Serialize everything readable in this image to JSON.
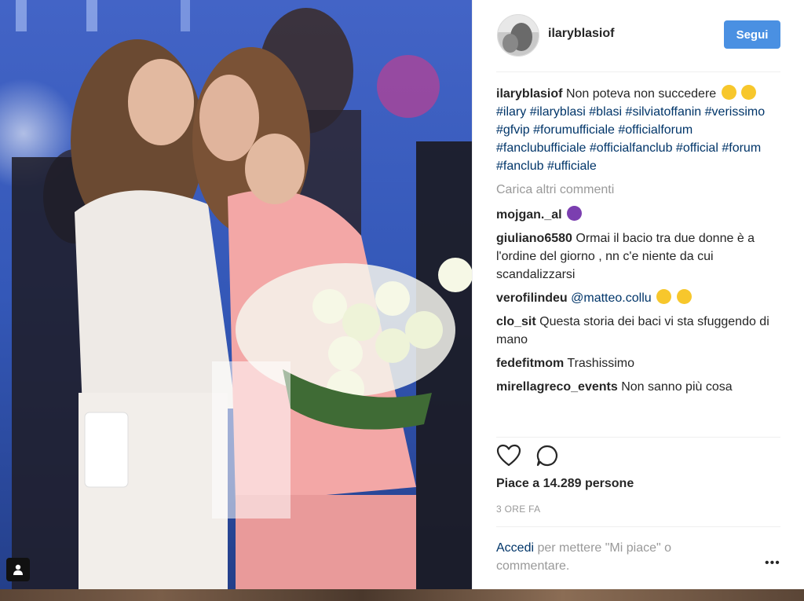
{
  "post": {
    "username": "ilaryblasiof",
    "follow_label": "Segui",
    "caption_user": "ilaryblasiof",
    "caption_text": "Non poteva non succedere",
    "hashtags": [
      "#ilary",
      "#ilaryblasi",
      "#blasi",
      "#silviatoffanin",
      "#verissimo",
      "#gfvip",
      "#forumufficiale",
      "#officialforum",
      "#fanclubufficiale",
      "#officialfanclub",
      "#official",
      "#forum",
      "#fanclub",
      "#ufficiale"
    ],
    "load_more": "Carica altri commenti",
    "likes": "Piace a 14.289 persone",
    "time": "3 ORE FA",
    "login_link": "Accedi",
    "login_rest": "per mettere \"Mi piace\" o commentare."
  },
  "comments": [
    {
      "user": "mojgan._al",
      "text": ""
    },
    {
      "user": "giuliano6580",
      "text": "Ormai il bacio tra due donne è a l'ordine del giorno , nn c'e niente da cui scandalizzarsi"
    },
    {
      "user": "verofilindeu",
      "mention": "@matteo.collu",
      "text": ""
    },
    {
      "user": "clo_sit",
      "text": "Questa storia dei baci vi sta sfuggendo di mano"
    },
    {
      "user": "fedefitmom",
      "text": "Trashissimo"
    },
    {
      "user": "mirellagreco_events",
      "text": "Non sanno più cosa"
    }
  ],
  "icons": {
    "like": "heart-icon",
    "comment": "comment-bubble-icon",
    "more": "more-options-icon",
    "tag": "user-tag-icon",
    "emoji_laugh": "tears-of-joy-emoji",
    "emoji_devil": "smiling-devil-emoji"
  },
  "colors": {
    "follow_button": "#4a90e2",
    "link": "#003569",
    "muted": "#999999"
  }
}
